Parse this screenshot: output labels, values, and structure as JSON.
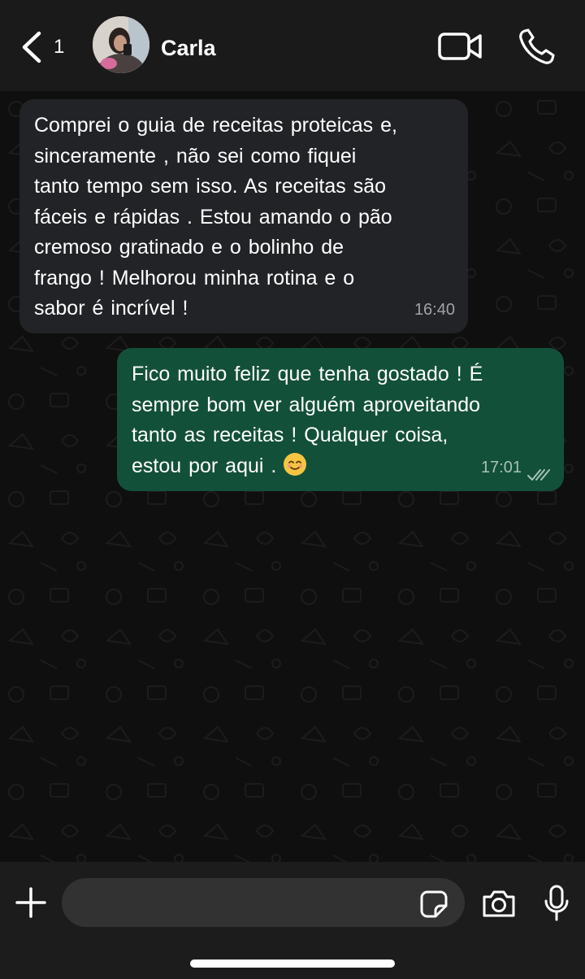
{
  "header": {
    "back_icon": "chevron-left-icon",
    "unread_count": "1",
    "contact_name": "Carla",
    "icons": [
      "video-call-icon",
      "phone-icon"
    ]
  },
  "messages": [
    {
      "direction": "incoming",
      "lines": [
        "Comprei  o guia de receitas  proteicas  e,",
        "sinceramente  , não sei como  fiquei",
        "tanto  tempo  sem isso. As receitas  são",
        "fáceis e rápidas . Estou amando  o pão",
        "cremoso  gratinado   e o bolinho  de",
        "frango ! Melhorou   minha  rotina  e o",
        "sabor  é incrível !"
      ],
      "time": "16:40"
    },
    {
      "direction": "outgoing",
      "lines": [
        "Fico muito  feliz que tenha  gostado ! É",
        "sempre  bom  ver alguém  aproveitando",
        "tanto  as receitas ! Qualquer  coisa,",
        "estou  por  aqui ."
      ],
      "emoji": "smiling-face-emoji",
      "time": "17:01",
      "status": "double-check-icon"
    }
  ],
  "composer": {
    "placeholder": "",
    "icons": [
      "plus-icon",
      "sticker-icon",
      "camera-icon",
      "microphone-icon"
    ]
  },
  "colors": {
    "header_bg": "#1a1a1a",
    "incoming_bubble": "#222326",
    "outgoing_bubble": "#13503a",
    "footer_bg": "#1c1c1c"
  }
}
